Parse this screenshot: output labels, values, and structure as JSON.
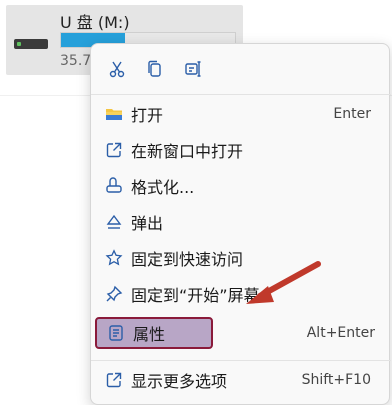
{
  "drive": {
    "name": "U 盘 (M:)",
    "free_text": "35.7",
    "usage_fraction": 0.37
  },
  "menu": {
    "quick_actions": [
      {
        "icon": "scissors-icon",
        "name": "cut"
      },
      {
        "icon": "copy-icon",
        "name": "copy"
      },
      {
        "icon": "rename-icon",
        "name": "rename"
      }
    ],
    "items": [
      {
        "label": "打开",
        "shortcut": "Enter",
        "icon": "folder-icon"
      },
      {
        "label": "在新窗口中打开",
        "shortcut": "",
        "icon": "external-window-icon"
      },
      {
        "label": "格式化...",
        "shortcut": "",
        "icon": "format-icon"
      },
      {
        "label": "弹出",
        "shortcut": "",
        "icon": "eject-icon"
      },
      {
        "label": "固定到快速访问",
        "shortcut": "",
        "icon": "star-icon"
      },
      {
        "label": "固定到“开始”屏幕",
        "shortcut": "",
        "icon": "pin-icon"
      },
      {
        "label": "属性",
        "shortcut": "Alt+Enter",
        "icon": "properties-icon"
      },
      {
        "label": "显示更多选项",
        "shortcut": "Shift+F10",
        "icon": "more-options-icon"
      }
    ]
  },
  "colors": {
    "accent": "#26a0da",
    "highlight_fill": "#b8a6c6",
    "highlight_border": "#8a1a3a",
    "arrow": "#c0392b"
  }
}
